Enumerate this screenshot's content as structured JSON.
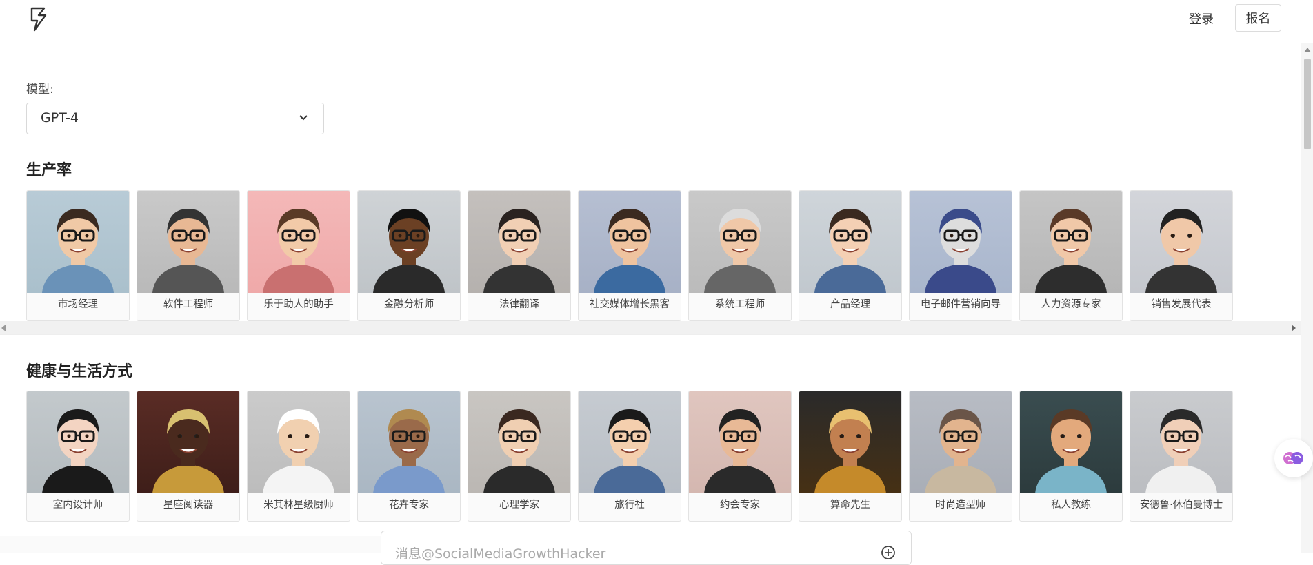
{
  "header": {
    "login_label": "登录",
    "signup_label": "报名"
  },
  "model": {
    "label": "模型:",
    "selected": "GPT-4"
  },
  "sections": [
    {
      "title": "生产率",
      "items": [
        "市场经理",
        "软件工程师",
        "乐于助人的助手",
        "金融分析师",
        "法律翻译",
        "社交媒体增长黑客",
        "系统工程师",
        "产品经理",
        "电子邮件营销向导",
        "人力资源专家",
        "销售发展代表"
      ]
    },
    {
      "title": "健康与生活方式",
      "items": [
        "室内设计师",
        "星座阅读器",
        "米其林星级厨师",
        "花卉专家",
        "心理学家",
        "旅行社",
        "约会专家",
        "算命先生",
        "时尚造型师",
        "私人教练",
        "安德鲁·休伯曼博士"
      ]
    }
  ],
  "message": {
    "placeholder": "消息@SocialMediaGrowthHacker"
  },
  "colors": {
    "accent": "#6b5bd6",
    "border": "#e3e3e3"
  },
  "icons": {
    "logo": "brand-logo-icon",
    "select": "chevron-down-icon",
    "float": "brain-icon",
    "add": "plus-circle-icon"
  }
}
